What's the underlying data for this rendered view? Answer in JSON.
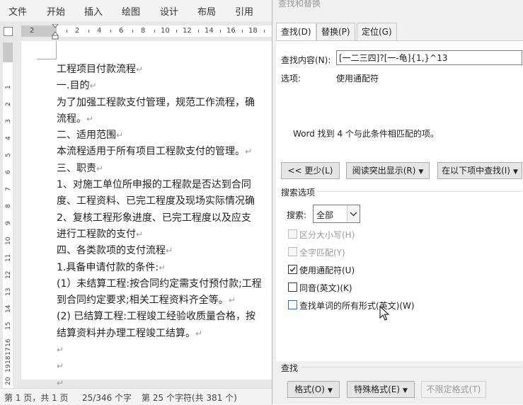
{
  "ribbon": {
    "tabs": [
      "文件",
      "开始",
      "插入",
      "绘图",
      "设计",
      "布局",
      "引用"
    ]
  },
  "ruler": {
    "numbers": [
      "2",
      "2",
      "4",
      "6",
      "8",
      "10",
      "12",
      "14",
      "16",
      "18"
    ],
    "vnumbers": [
      "1",
      "2",
      "3",
      "4",
      "5",
      "6",
      "7",
      "8",
      "9",
      "10",
      "11",
      "12",
      "13",
      "14",
      "15",
      "16",
      "17",
      "18",
      "19",
      "20"
    ]
  },
  "document": {
    "lines": [
      "工程项目付款流程",
      "一.目的",
      "为了加强工程款支付管理，规范工作流程，确",
      "流程。",
      "二、适用范围",
      "本流程适用于所有项目工程款支付的管理。",
      "三、职责",
      "1、对施工单位所申报的工程款是否达到合同",
      "度、工程资料、已完工程度及现场实际情况确",
      "2、复核工程形象进度、已完工程度以及应支",
      "进行工程款的支付",
      "四、各类款项的支付流程",
      "1.具备申请付款的条件:",
      "(1）未结算工程:按合同约定需支付预付款;工程",
      "到合同约定要求;相关工程资料齐全等。",
      "(2) 已结算工程:工程竣工经验收质量合格，按",
      "结算资料并办理工程竣工结算。",
      "",
      "",
      ""
    ],
    "paragraph_mark": "↵"
  },
  "status": {
    "page": "第 1 页，共 1 页",
    "words": "25/346 个字",
    "chars": "第 25 个字符(共 381 个)"
  },
  "dialog": {
    "title": "查找和替换",
    "tabs": [
      "查找(D)",
      "替换(P)",
      "定位(G)"
    ],
    "find_label": "查找内容(N):",
    "find_value": "[一二三四]?[一-龟]{1,}^13",
    "options_label": "选项:",
    "options_value": "使用通配符",
    "result": "Word 找到 4 个与此条件相匹配的项。",
    "less_button": "<< 更少(L)",
    "highlight_button": "阅读突出显示(R)",
    "findin_button": "在以下项中查找(I)",
    "search_options_title": "搜索选项",
    "search_label": "搜索:",
    "search_value": "全部",
    "checkboxes": [
      {
        "label": "区分大小写(H)",
        "checked": false,
        "enabled": false
      },
      {
        "label": "全字匹配(Y)",
        "checked": false,
        "enabled": false
      },
      {
        "label": "使用通配符(U)",
        "checked": true,
        "enabled": true
      },
      {
        "label": "同音(英文)(K)",
        "checked": false,
        "enabled": true
      },
      {
        "label": "查找单词的所有形式(英文)(W)",
        "checked": false,
        "enabled": true
      }
    ],
    "find_section_title": "查找",
    "format_button": "格式(O)",
    "special_button": "特殊格式(E)",
    "noformat_button": "不限定格式(T)"
  },
  "colors": {
    "accent": "#1e6fd9",
    "dialog_bg": "#f0f0f0",
    "ruler_bg": "#e8e8e8"
  }
}
